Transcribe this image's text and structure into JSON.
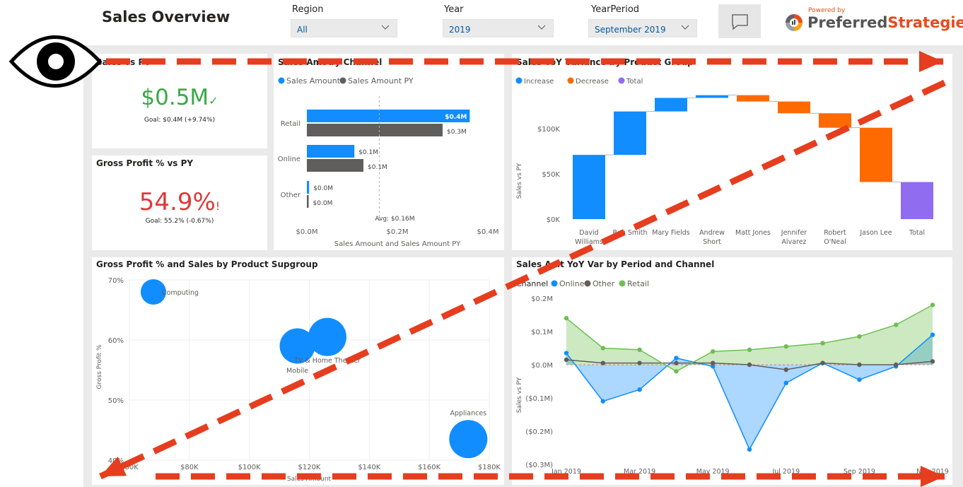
{
  "header": {
    "title": "Sales Overview",
    "filters": [
      {
        "label": "Region",
        "value": "All"
      },
      {
        "label": "Year",
        "value": "2019"
      },
      {
        "label": "YearPeriod",
        "value": "September 2019"
      }
    ],
    "brand": {
      "powered_by": "Powered by",
      "name_part1": "Preferred",
      "name_part2": "Strategies"
    }
  },
  "kpis": {
    "sales": {
      "title": "Sales vs PY",
      "value": "$0.5M",
      "goal": "Goal: $0.4M (+9.74%)",
      "color": "#3aa845"
    },
    "gross_profit": {
      "title": "Gross Profit % vs PY",
      "value": "54.9%",
      "goal": "Goal: 55.2% (-0.67%)",
      "color": "#dd3a3a"
    }
  },
  "tiles": {
    "channel": "Sales Amt by Channel",
    "waterfall": "Sales YoY Variance by Product Group",
    "bubble": "Gross Profit %  and Sales by Product Supgroup",
    "line": "Sales Amt YoY Var by Period and Channel"
  },
  "colors": {
    "blue": "#118dff",
    "gray": "#605e5c",
    "orange": "#ff6a00",
    "purple": "#8f6cf0",
    "green": "#6cbf4f",
    "annotation": "#e63d1f"
  },
  "chart_data": [
    {
      "type": "bar",
      "orientation": "horizontal",
      "categories": [
        "Retail",
        "Online",
        "Other"
      ],
      "legend": [
        "Sales Amount",
        "Sales Amount PY"
      ],
      "series": [
        {
          "name": "Sales Amount",
          "values": [
            0.36,
            0.105,
            0.005
          ],
          "labels": [
            "$0.4M",
            "$0.1M",
            "$0.0M"
          ]
        },
        {
          "name": "Sales Amount PY",
          "values": [
            0.3,
            0.125,
            0.004
          ],
          "labels": [
            "$0.3M",
            "$0.1M",
            "$0.0M"
          ]
        }
      ],
      "reference_line": {
        "value": 0.16,
        "label": "Avg: $0.16M"
      },
      "xticks": [
        "$0.0M",
        "$0.2M",
        "$0.4M"
      ],
      "xlim": [
        0,
        0.4
      ],
      "xlabel": "Sales Amount and Sales Amount PY"
    },
    {
      "type": "waterfall",
      "legend": [
        "Increase",
        "Decrease",
        "Total"
      ],
      "categories": [
        [
          "David",
          "Williams"
        ],
        [
          "Ben Smith"
        ],
        [
          "Mary Fields"
        ],
        [
          "Andrew",
          "Short"
        ],
        [
          "Matt Jones"
        ],
        [
          "Jennifer",
          "Alvarez"
        ],
        [
          "Robert",
          "O'Neal"
        ],
        [
          "Jason Lee"
        ],
        [
          "Total"
        ]
      ],
      "deltas": [
        71000,
        48000,
        15000,
        3000,
        -7000,
        -13000,
        -16000,
        -60000,
        null
      ],
      "kinds": [
        "increase",
        "increase",
        "increase",
        "increase",
        "decrease",
        "decrease",
        "decrease",
        "decrease",
        "total"
      ],
      "total": 41000,
      "yticks": [
        "$0K",
        "$50K",
        "$100K"
      ],
      "ylim": [
        0,
        140000
      ],
      "ylabel": "Sales vs PY"
    },
    {
      "type": "scatter",
      "points": [
        {
          "label": "Computing",
          "x": 68000,
          "y": 68
        },
        {
          "label": "Mobile",
          "x": 116000,
          "y": 59
        },
        {
          "label": "TV & Home Theater",
          "x": 126000,
          "y": 60.5
        },
        {
          "label": "Appliances",
          "x": 173000,
          "y": 43.5
        }
      ],
      "xticks": [
        "$60K",
        "$80K",
        "$100K",
        "$120K",
        "$140K",
        "$160K",
        "$180K"
      ],
      "yticks": [
        "40%",
        "50%",
        "60%",
        "70%"
      ],
      "xlim": [
        60000,
        180000
      ],
      "ylim": [
        40,
        70
      ],
      "xlabel": "Sales Amount",
      "ylabel": "Gross Profit %"
    },
    {
      "type": "area",
      "legend_title": "Channel",
      "legend": [
        "Online",
        "Other",
        "Retail"
      ],
      "x": [
        "Jan 2019",
        "Feb 2019",
        "Mar 2019",
        "Apr 2019",
        "May 2019",
        "Jun 2019",
        "Jul 2019",
        "Aug 2019",
        "Sep 2019",
        "Oct 2019",
        "Nov 2019",
        "Dec 2019"
      ],
      "xticks_visible": [
        "Jan 2019",
        "Mar 2019",
        "May 2019",
        "Jul 2019",
        "Sep 2019",
        "Nov 2019"
      ],
      "series": [
        {
          "name": "Online",
          "values": [
            0.035,
            -0.11,
            -0.075,
            0.02,
            -0.005,
            -0.255,
            -0.055,
            0.005,
            -0.045,
            -0.005,
            0.09
          ]
        },
        {
          "name": "Other",
          "values": [
            0.015,
            0.005,
            0.005,
            0.005,
            0.005,
            0.0,
            -0.015,
            0.005,
            0.0,
            0.0,
            0.01
          ]
        },
        {
          "name": "Retail",
          "values": [
            0.14,
            0.05,
            0.045,
            -0.02,
            0.04,
            0.045,
            0.055,
            0.065,
            0.085,
            0.12,
            0.18
          ]
        }
      ],
      "yticks": [
        "$0.2M",
        "$0.1M",
        "$0.0M",
        "($0.1M)",
        "($0.2M)",
        "($0.3M)"
      ],
      "ylim": [
        -0.3,
        0.2
      ],
      "ylabel": "Sales vs PY"
    }
  ]
}
